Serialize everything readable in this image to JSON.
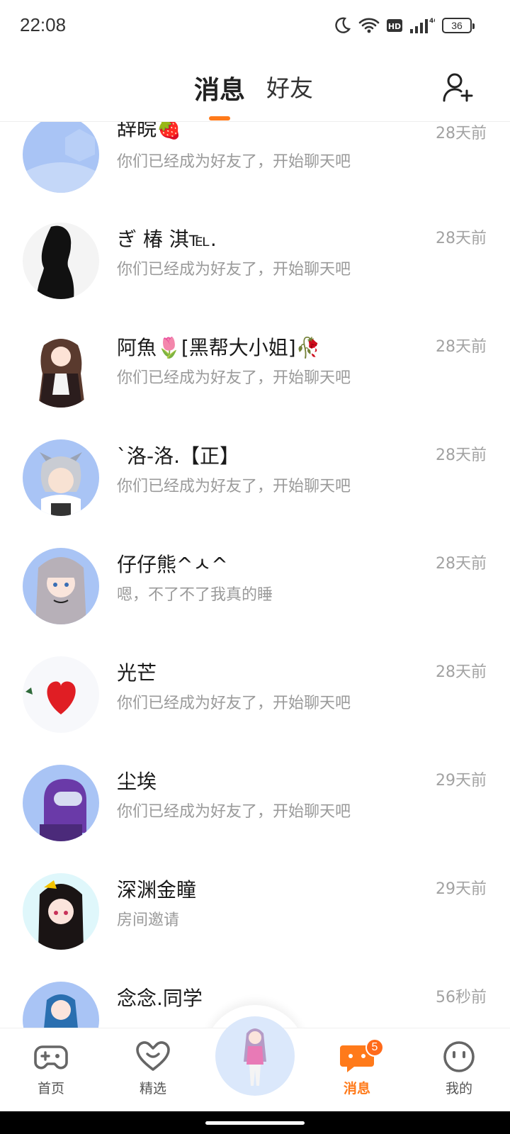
{
  "status_bar": {
    "time": "22:08",
    "battery": "36",
    "network": "4G",
    "icons": [
      "moon-icon",
      "wifi-icon",
      "hd-icon",
      "signal-icon",
      "battery-icon"
    ]
  },
  "header": {
    "tabs": [
      {
        "label": "消息",
        "active": true
      },
      {
        "label": "好友",
        "active": false
      }
    ],
    "accent_color": "#ff7a1a",
    "add_friend_icon": "add-friend-icon"
  },
  "conversations": [
    {
      "name": "辞皖🍓",
      "preview": "你们已经成为好友了，开始聊天吧",
      "time": "28天前"
    },
    {
      "name": "ぎ 椿 淇℡.",
      "preview": "你们已经成为好友了，开始聊天吧",
      "time": "28天前"
    },
    {
      "name": "阿魚🌷[黑帮大小姐]🥀",
      "preview": "你们已经成为好友了，开始聊天吧",
      "time": "28天前"
    },
    {
      "name": "`洛-洛.【正】",
      "preview": "你们已经成为好友了，开始聊天吧",
      "time": "28天前"
    },
    {
      "name": "仔仔熊^ㅅ^",
      "preview": "嗯，不了不了我真的睡",
      "time": "28天前"
    },
    {
      "name": "光芒",
      "preview": "你们已经成为好友了，开始聊天吧",
      "time": "28天前"
    },
    {
      "name": "尘埃",
      "preview": "你们已经成为好友了，开始聊天吧",
      "time": "29天前"
    },
    {
      "name": "深渊金瞳",
      "preview": "房间邀请",
      "time": "29天前"
    },
    {
      "name": "念念.同学",
      "preview": "",
      "time": "56秒前"
    }
  ],
  "bottom_nav": {
    "items": [
      {
        "label": "首页",
        "icon": "gamepad-icon"
      },
      {
        "label": "精选",
        "icon": "heart-icon"
      },
      {
        "label": "消息",
        "icon": "chat-icon",
        "badge": "5",
        "active": true
      },
      {
        "label": "我的",
        "icon": "face-icon"
      }
    ]
  }
}
